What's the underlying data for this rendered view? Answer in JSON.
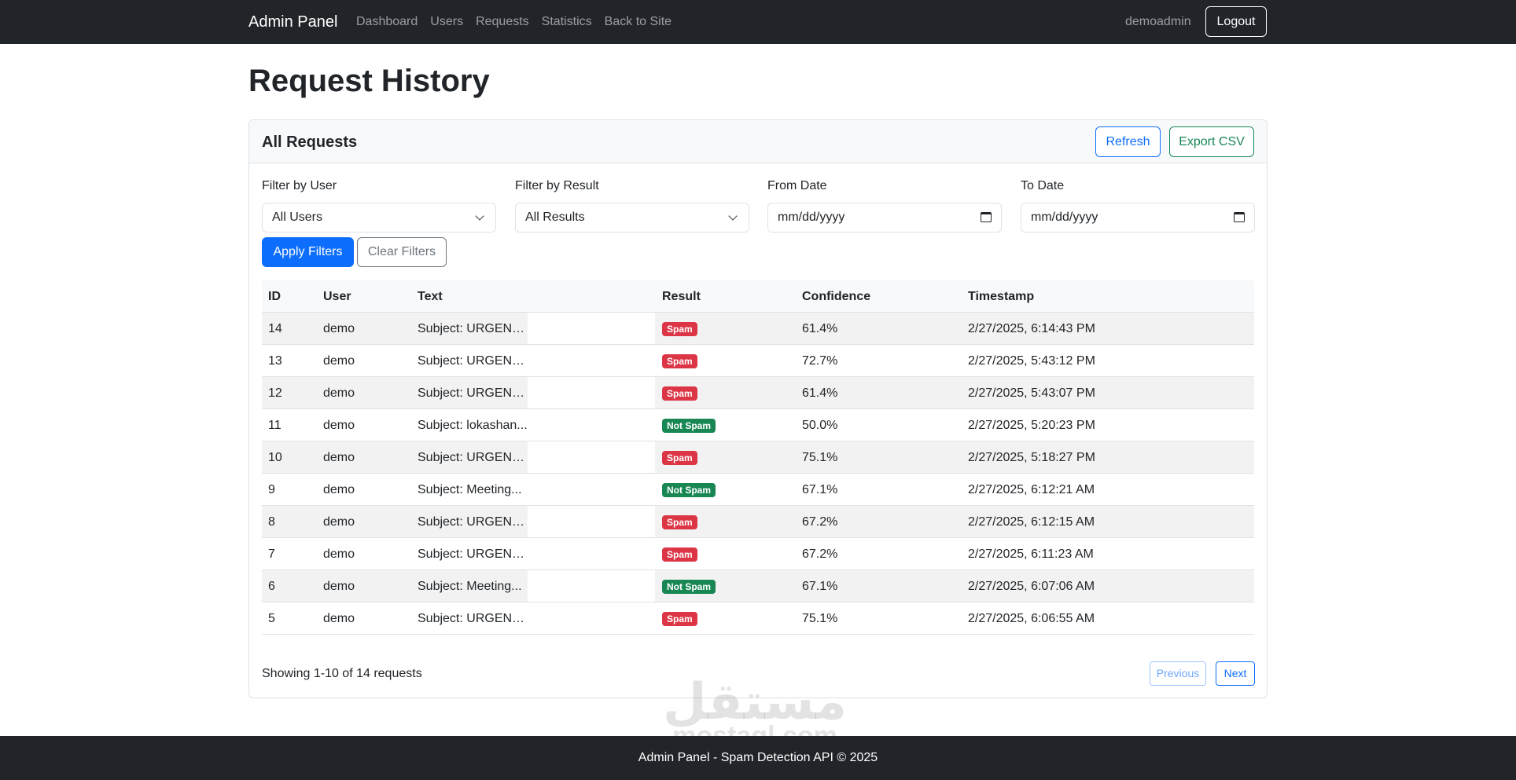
{
  "navbar": {
    "brand": "Admin Panel",
    "links": [
      "Dashboard",
      "Users",
      "Requests",
      "Statistics",
      "Back to Site"
    ],
    "username": "demoadmin",
    "logout": "Logout"
  },
  "page": {
    "title": "Request History"
  },
  "card": {
    "title": "All Requests",
    "refresh": "Refresh",
    "export": "Export CSV"
  },
  "filters": {
    "user": {
      "label": "Filter by User",
      "value": "All Users"
    },
    "result": {
      "label": "Filter by Result",
      "value": "All Results"
    },
    "from": {
      "label": "From Date",
      "value": "mm/dd/yyyy"
    },
    "to": {
      "label": "To Date",
      "value": "mm/dd/yyyy"
    },
    "apply": "Apply Filters",
    "clear": "Clear Filters"
  },
  "table": {
    "headers": {
      "id": "ID",
      "user": "User",
      "text": "Text",
      "result": "Result",
      "confidence": "Confidence",
      "timestamp": "Timestamp"
    },
    "rows": [
      {
        "id": "14",
        "user": "demo",
        "text": "Subject: URGENT...",
        "result": "Spam",
        "confidence": "61.4%",
        "timestamp": "2/27/2025, 6:14:43 PM"
      },
      {
        "id": "13",
        "user": "demo",
        "text": "Subject: URGENT...",
        "result": "Spam",
        "confidence": "72.7%",
        "timestamp": "2/27/2025, 5:43:12 PM"
      },
      {
        "id": "12",
        "user": "demo",
        "text": "Subject: URGENT...",
        "result": "Spam",
        "confidence": "61.4%",
        "timestamp": "2/27/2025, 5:43:07 PM"
      },
      {
        "id": "11",
        "user": "demo",
        "text": "Subject: lokashan...",
        "result": "Not Spam",
        "confidence": "50.0%",
        "timestamp": "2/27/2025, 5:20:23 PM"
      },
      {
        "id": "10",
        "user": "demo",
        "text": "Subject: URGENT...",
        "result": "Spam",
        "confidence": "75.1%",
        "timestamp": "2/27/2025, 5:18:27 PM"
      },
      {
        "id": "9",
        "user": "demo",
        "text": "Subject: Meeting...",
        "result": "Not Spam",
        "confidence": "67.1%",
        "timestamp": "2/27/2025, 6:12:21 AM"
      },
      {
        "id": "8",
        "user": "demo",
        "text": "Subject: URGENT...",
        "result": "Spam",
        "confidence": "67.2%",
        "timestamp": "2/27/2025, 6:12:15 AM"
      },
      {
        "id": "7",
        "user": "demo",
        "text": "Subject: URGENT...",
        "result": "Spam",
        "confidence": "67.2%",
        "timestamp": "2/27/2025, 6:11:23 AM"
      },
      {
        "id": "6",
        "user": "demo",
        "text": "Subject: Meeting...",
        "result": "Not Spam",
        "confidence": "67.1%",
        "timestamp": "2/27/2025, 6:07:06 AM"
      },
      {
        "id": "5",
        "user": "demo",
        "text": "Subject: URGENT...",
        "result": "Spam",
        "confidence": "75.1%",
        "timestamp": "2/27/2025, 6:06:55 AM"
      }
    ]
  },
  "pagination": {
    "showing": "Showing 1-10 of 14 requests",
    "previous": "Previous",
    "next": "Next"
  },
  "watermark": {
    "arabic": "مستقل",
    "latin": "mostaql.com"
  },
  "footer": {
    "text": "Admin Panel - Spam Detection API © 2025"
  },
  "colors": {
    "spam": "#dc3545",
    "not_spam": "#198754",
    "primary": "#0d6efd",
    "navbar": "#212529"
  }
}
